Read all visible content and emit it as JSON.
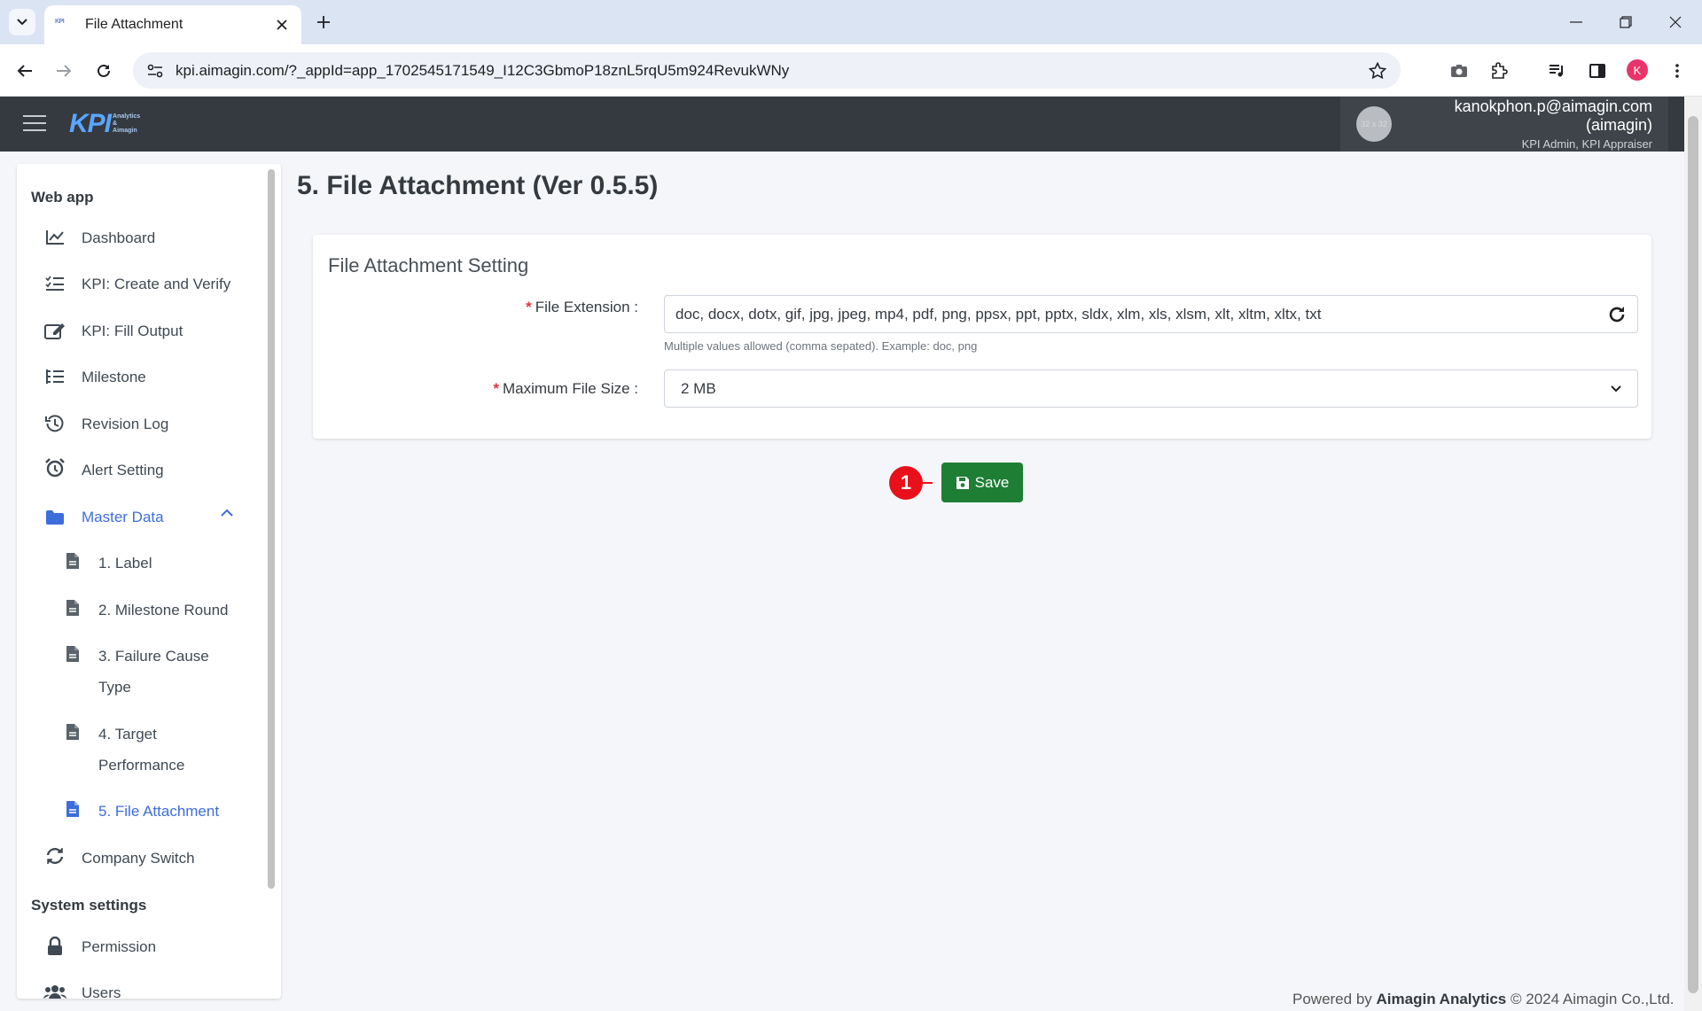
{
  "browser": {
    "tab_title": "File Attachment",
    "favicon_text": "KPI",
    "url": "kpi.aimagin.com/?_appId=app_1702545171549_I12C3GbmoP18znL5rqU5m924RevukWNy",
    "profile_initial": "K"
  },
  "header": {
    "logo_main": "KPI",
    "logo_sub_1": "Analytics",
    "logo_sub_2": "&",
    "logo_sub_3": "Aimagin",
    "avatar_placeholder": "32 x 32",
    "user_email": "kanokphon.p@aimagin.com (aimagin)",
    "user_roles": "KPI Admin, KPI Appraiser"
  },
  "sidebar": {
    "section_webapp": "Web app",
    "items": [
      {
        "label": "Dashboard",
        "icon": "chart-line-icon"
      },
      {
        "label": "KPI: Create and Verify",
        "icon": "checklist-icon"
      },
      {
        "label": "KPI: Fill Output",
        "icon": "edit-icon"
      },
      {
        "label": "Milestone",
        "icon": "tasks-icon"
      },
      {
        "label": "Revision Log",
        "icon": "history-icon"
      },
      {
        "label": "Alert Setting",
        "icon": "alarm-icon"
      },
      {
        "label": "Master Data",
        "icon": "folder-icon"
      },
      {
        "label": "Company Switch",
        "icon": "sync-icon"
      }
    ],
    "master_data_children": [
      {
        "label_1": "1. Label"
      },
      {
        "label_1": "2. Milestone Round"
      },
      {
        "label_1": "3. Failure Cause",
        "label_2": "Type"
      },
      {
        "label_1": "4. Target",
        "label_2": "Performance"
      },
      {
        "label_1": "5. File Attachment"
      }
    ],
    "section_system": "System settings",
    "system_items": [
      {
        "label": "Permission",
        "icon": "lock-icon"
      },
      {
        "label": "Users",
        "icon": "users-icon"
      }
    ]
  },
  "main": {
    "page_title": "5. File Attachment (Ver 0.5.5)",
    "card_title": "File Attachment Setting",
    "file_extension_label": "File Extension :",
    "file_extension_value": "doc, docx, dotx, gif, jpg, jpeg, mp4, pdf, png, ppsx, ppt, pptx, sldx, xlm, xls, xlsm, xlt, xltm, xltx, txt",
    "file_extension_help": "Multiple values allowed (comma sepated). Example: doc, png",
    "max_size_label": "Maximum File Size :",
    "max_size_value": "2 MB",
    "required_mark": "*",
    "save_label": "Save",
    "step_marker": "1"
  },
  "footer": {
    "prefix": "Powered by",
    "brand": "Aimagin Analytics",
    "suffix": "© 2024 Aimagin Co.,Ltd."
  },
  "colors": {
    "header_bg": "#343a40",
    "accent": "#3d6ddb",
    "save_green": "#1e7e34",
    "required_red": "#dc3545",
    "marker_red": "#e8101b"
  }
}
